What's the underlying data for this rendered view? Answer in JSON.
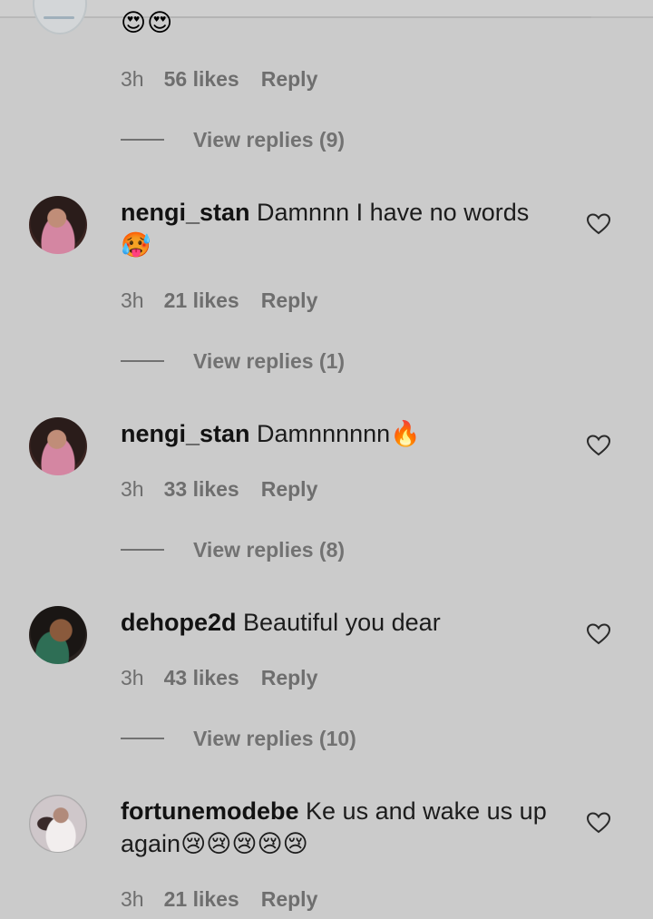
{
  "top_comment": {
    "emoji_text": "😍😍",
    "time": "3h",
    "likes": "56 likes",
    "reply": "Reply",
    "view_replies": "View replies (9)"
  },
  "comments": [
    {
      "username": "nengi_stan",
      "text": "Damnnn I have no words",
      "emoji": "🥵",
      "time": "3h",
      "likes": "21 likes",
      "reply": "Reply",
      "view_replies": "View replies (1)"
    },
    {
      "username": "nengi_stan",
      "text": "Damnnnnnn",
      "emoji": "🔥",
      "time": "3h",
      "likes": "33 likes",
      "reply": "Reply",
      "view_replies": "View replies (8)"
    },
    {
      "username": "dehope2d",
      "text": "Beautiful you dear",
      "time": "3h",
      "likes": "43 likes",
      "reply": "Reply",
      "view_replies": "View replies (10)"
    },
    {
      "username": "fortunemodebe",
      "text": "Ke us and wake us up again",
      "emoji": "😢😢😢😢😢",
      "time": "3h",
      "likes": "21 likes",
      "reply": "Reply"
    }
  ],
  "icons": {
    "like": "heart-outline-icon",
    "avatar": "user-avatar"
  }
}
